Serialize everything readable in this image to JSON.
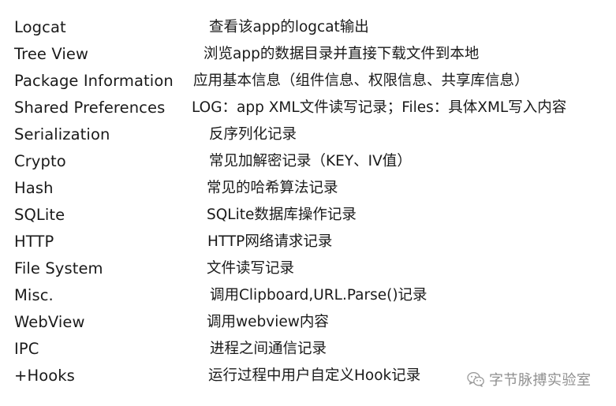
{
  "rows": [
    {
      "name": "Logcat",
      "desc": "查看该app的logcat输出"
    },
    {
      "name": "Tree View",
      "desc": "浏览app的数据目录并直接下载文件到本地"
    },
    {
      "name": "Package Information",
      "desc": "应用基本信息（组件信息、权限信息、共享库信息）"
    },
    {
      "name": "Shared Preferences",
      "desc": "LOG：app XML文件读写记录；Files：具体XML写入内容"
    },
    {
      "name": "Serialization",
      "desc": "反序列化记录"
    },
    {
      "name": "Crypto",
      "desc": "常见加解密记录（KEY、IV值）"
    },
    {
      "name": "Hash",
      "desc": "常见的哈希算法记录"
    },
    {
      "name": "SQLite",
      "desc": "SQLite数据库操作记录"
    },
    {
      "name": "HTTP",
      "desc": "HTTP网络请求记录"
    },
    {
      "name": "File System",
      "desc": "文件读写记录"
    },
    {
      "name": "Misc.",
      "desc": "调用Clipboard,URL.Parse()记录"
    },
    {
      "name": "WebView",
      "desc": "调用webview内容"
    },
    {
      "name": "IPC",
      "desc": "进程之间通信记录"
    },
    {
      "name": "+Hooks",
      "desc": "运行过程中用户自定义Hook记录"
    }
  ],
  "watermark": {
    "text": "字节脉搏实验室",
    "icon": "wechat-icon",
    "color": "#8f8f8f"
  }
}
